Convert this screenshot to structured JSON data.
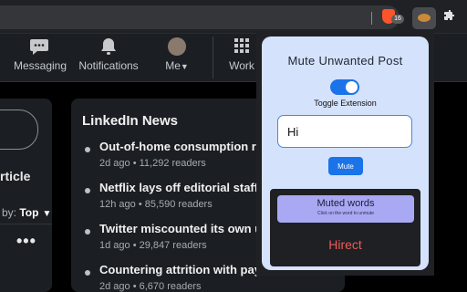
{
  "browser": {
    "shields_badge": "16",
    "extension_icon": "mute-extension-icon",
    "puzzle_icon": "extensions-puzzle-icon"
  },
  "nav": {
    "items": [
      {
        "label": "Messaging",
        "icon": "messaging-icon"
      },
      {
        "label": "Notifications",
        "icon": "bell-icon"
      },
      {
        "label": "Me",
        "icon": "avatar"
      },
      {
        "label": "Work",
        "icon": "grid-icon"
      }
    ]
  },
  "left": {
    "partial_text": "rticle",
    "sort_prefix": "by:",
    "sort_value": "Top",
    "more": "•••"
  },
  "news": {
    "title": "LinkedIn News",
    "items": [
      {
        "headline": "Out-of-home consumption r",
        "meta": "2d ago • 11,292 readers"
      },
      {
        "headline": "Netflix lays off editorial staff",
        "meta": "12h ago • 85,590 readers"
      },
      {
        "headline": "Twitter miscounted its own u",
        "meta": "1d ago • 29,847 readers"
      },
      {
        "headline": "Countering attrition with pay",
        "meta": "2d ago • 6,670 readers"
      }
    ]
  },
  "popup": {
    "title": "Mute Unwanted Post",
    "toggle_label": "Toggle Extension",
    "toggle_on": true,
    "input_value": "Hi",
    "mute_button": "Mute",
    "muted_header": "Muted words",
    "muted_hint": "Click on the word to unmute",
    "muted_words": [
      "Hirect"
    ]
  },
  "colors": {
    "accent": "#1a73e8",
    "popup_bg": "#d5e2fb",
    "muted_word": "#ef5a5a",
    "muted_header_bg": "#a9a8f2"
  }
}
